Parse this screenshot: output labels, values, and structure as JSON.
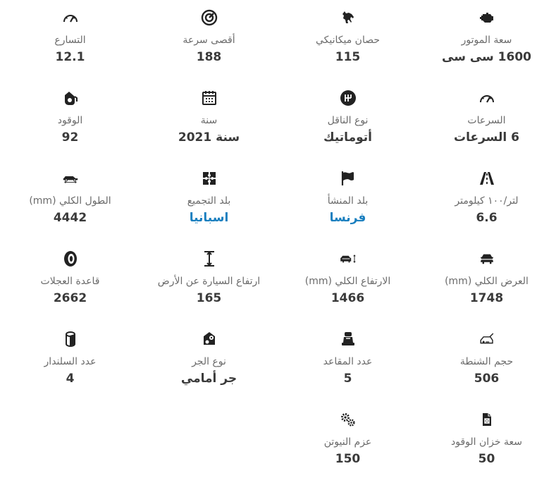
{
  "specs": [
    {
      "icon": "engine-icon",
      "label": "سعة الموتور",
      "value": "1600 سى سى"
    },
    {
      "icon": "horse-icon",
      "label": "حصان ميكانيكي",
      "value": "115"
    },
    {
      "icon": "speed-circle-icon",
      "label": "أقصى سرعة",
      "value": "188"
    },
    {
      "icon": "speedometer-icon",
      "label": "التسارع",
      "value": "12.1"
    },
    {
      "icon": "speedometer-icon",
      "label": "السرعات",
      "value": "6 السرعات"
    },
    {
      "icon": "gear-shift-icon",
      "label": "نوع الناقل",
      "value": "أتوماتيك"
    },
    {
      "icon": "calendar-icon",
      "label": "سنة",
      "value": "سنة 2021"
    },
    {
      "icon": "fuel-pump-icon",
      "label": "الوقود",
      "value": "92"
    },
    {
      "icon": "road-icon",
      "label": "لتر/١٠٠ كيلومتر",
      "value": "6.6"
    },
    {
      "icon": "flag-icon",
      "label": "بلد المنشأ",
      "value": "فرنسا",
      "link": true
    },
    {
      "icon": "puzzle-icon",
      "label": "بلد التجميع",
      "value": "اسبانيا",
      "link": true
    },
    {
      "icon": "car-length-icon",
      "label": "الطول الكلي (mm)",
      "value": "4442"
    },
    {
      "icon": "car-width-icon",
      "label": "العرض الكلي (mm)",
      "value": "1748"
    },
    {
      "icon": "car-height-icon",
      "label": "الارتفاع الكلي (mm)",
      "value": "1466"
    },
    {
      "icon": "ground-clearance-icon",
      "label": "ارتفاع السيارة عن الأرض",
      "value": "165"
    },
    {
      "icon": "tire-icon",
      "label": "قاعدة العجلات",
      "value": "2662"
    },
    {
      "icon": "trunk-icon",
      "label": "حجم الشنطة",
      "value": "506"
    },
    {
      "icon": "car-seat-icon",
      "label": "عدد المقاعد",
      "value": "5"
    },
    {
      "icon": "drivetrain-icon",
      "label": "نوع الجر",
      "value": "جر أمامي"
    },
    {
      "icon": "cylinder-icon",
      "label": "عدد السلندار",
      "value": "4"
    },
    {
      "icon": "fuel-tank-icon",
      "label": "سعة خزان الوقود",
      "value": "50"
    },
    {
      "icon": "gears-icon",
      "label": "عزم النيوتن",
      "value": "150"
    }
  ]
}
